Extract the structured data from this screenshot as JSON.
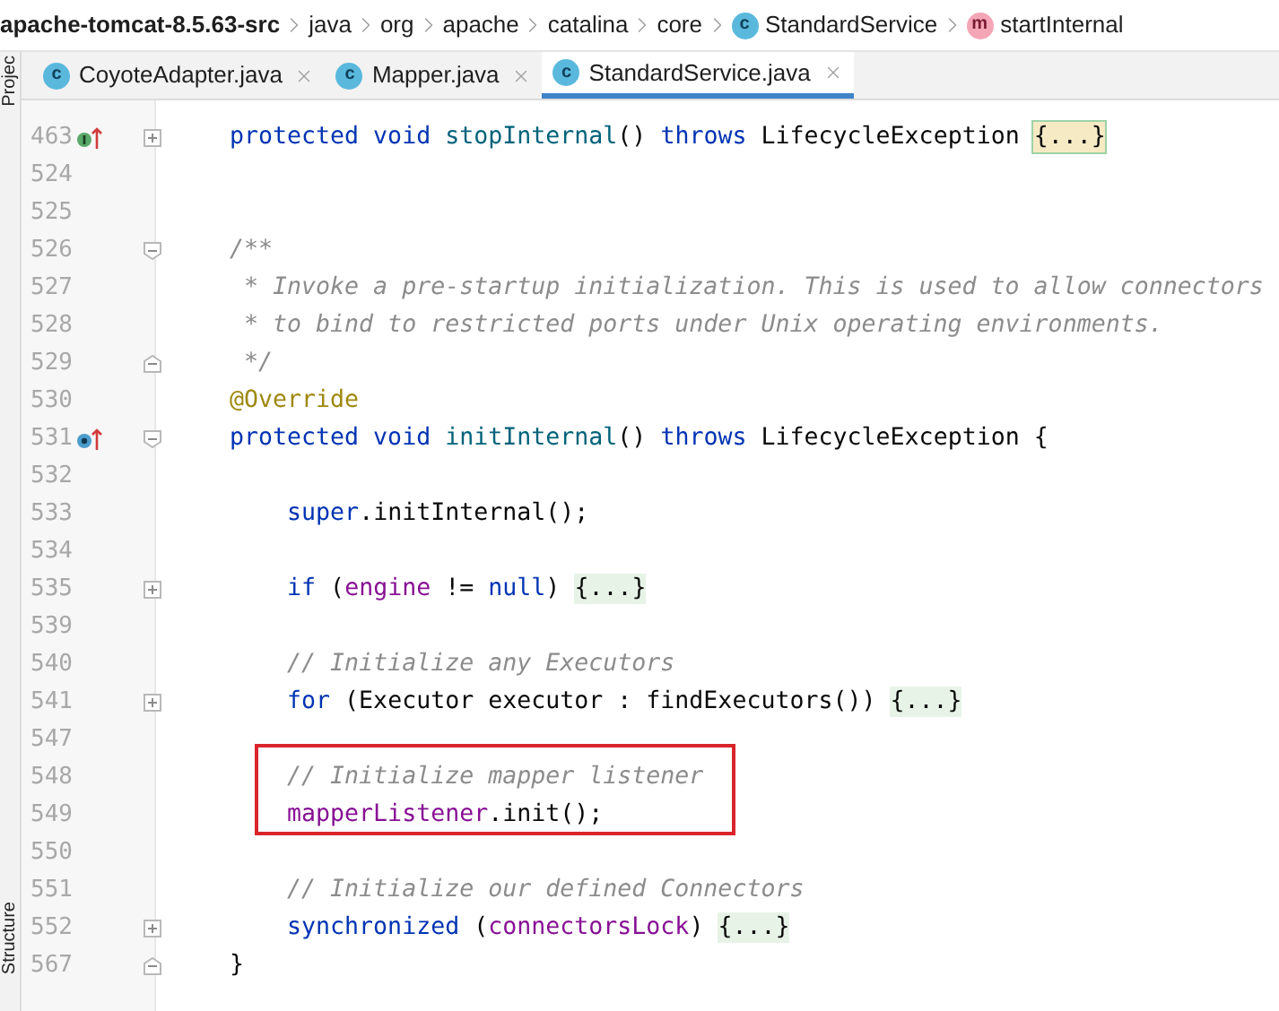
{
  "breadcrumb": [
    {
      "kind": "project",
      "label": "apache-tomcat-8.5.63-src"
    },
    {
      "kind": "folder",
      "label": "java"
    },
    {
      "kind": "folder",
      "label": "org"
    },
    {
      "kind": "folder",
      "label": "apache"
    },
    {
      "kind": "folder",
      "label": "catalina"
    },
    {
      "kind": "folder",
      "label": "core"
    },
    {
      "kind": "class",
      "label": "StandardService",
      "icon_letter": "c"
    },
    {
      "kind": "method",
      "label": "startInternal",
      "icon_letter": "m"
    }
  ],
  "side_tabs": {
    "top": "Projec",
    "bottom": "Structure"
  },
  "tabs": [
    {
      "label": "CoyoteAdapter.java",
      "icon_letter": "c",
      "selected": false
    },
    {
      "label": "Mapper.java",
      "icon_letter": "c",
      "selected": false
    },
    {
      "label": "StandardService.java",
      "icon_letter": "c",
      "selected": true
    }
  ],
  "lines": [
    {
      "number": "463",
      "marker": {
        "kind": "implements"
      },
      "fold": {
        "kind": "collapsed"
      },
      "tokens": [
        {
          "kind": "kw",
          "text": "protected void "
        },
        {
          "kind": "fn",
          "text": "stopInternal"
        },
        {
          "kind": "plain",
          "text": "() "
        },
        {
          "kind": "kw",
          "text": "throws "
        },
        {
          "kind": "plain",
          "text": "LifecycleException "
        },
        {
          "kind": "folded",
          "text": "{...}",
          "highlighted": true
        }
      ]
    },
    {
      "number": "524"
    },
    {
      "number": "525"
    },
    {
      "number": "526",
      "fold": {
        "kind": "open"
      },
      "tokens": [
        {
          "kind": "comment",
          "text": "/**"
        }
      ]
    },
    {
      "number": "527",
      "tokens": [
        {
          "kind": "comment",
          "text": " * Invoke a pre-startup initialization. This is used to allow connectors"
        }
      ]
    },
    {
      "number": "528",
      "tokens": [
        {
          "kind": "comment",
          "text": " * to bind to restricted ports under Unix operating environments."
        }
      ]
    },
    {
      "number": "529",
      "fold": {
        "kind": "close"
      },
      "tokens": [
        {
          "kind": "comment",
          "text": " */"
        }
      ]
    },
    {
      "number": "530",
      "tokens": [
        {
          "kind": "annotation",
          "text": "@Override"
        }
      ]
    },
    {
      "number": "531",
      "marker": {
        "kind": "overrides"
      },
      "fold": {
        "kind": "open"
      },
      "tokens": [
        {
          "kind": "kw",
          "text": "protected void "
        },
        {
          "kind": "fn",
          "text": "initInternal"
        },
        {
          "kind": "plain",
          "text": "() "
        },
        {
          "kind": "kw",
          "text": "throws "
        },
        {
          "kind": "plain",
          "text": "LifecycleException {"
        }
      ]
    },
    {
      "number": "532"
    },
    {
      "number": "533",
      "tokens": [
        {
          "kind": "kw",
          "text": "    super"
        },
        {
          "kind": "plain",
          "text": ".initInternal();"
        }
      ]
    },
    {
      "number": "534"
    },
    {
      "number": "535",
      "fold": {
        "kind": "collapsed"
      },
      "tokens": [
        {
          "kind": "kw",
          "text": "    if "
        },
        {
          "kind": "plain",
          "text": "("
        },
        {
          "kind": "field",
          "text": "engine"
        },
        {
          "kind": "plain",
          "text": " != "
        },
        {
          "kind": "kw",
          "text": "null"
        },
        {
          "kind": "plain",
          "text": ") "
        },
        {
          "kind": "folded",
          "text": "{...}",
          "highlighted": false
        }
      ]
    },
    {
      "number": "539"
    },
    {
      "number": "540",
      "tokens": [
        {
          "kind": "comment",
          "text": "    // Initialize any Executors"
        }
      ]
    },
    {
      "number": "541",
      "fold": {
        "kind": "collapsed"
      },
      "tokens": [
        {
          "kind": "kw",
          "text": "    for "
        },
        {
          "kind": "plain",
          "text": "(Executor executor : findExecutors()) "
        },
        {
          "kind": "folded",
          "text": "{...}",
          "highlighted": false
        }
      ]
    },
    {
      "number": "547"
    },
    {
      "number": "548",
      "boxed": true,
      "tokens": [
        {
          "kind": "comment",
          "text": "    // Initialize mapper listener"
        }
      ]
    },
    {
      "number": "549",
      "boxed": true,
      "tokens": [
        {
          "kind": "field",
          "text": "    mapperListener"
        },
        {
          "kind": "plain",
          "text": ".init();"
        }
      ]
    },
    {
      "number": "550"
    },
    {
      "number": "551",
      "tokens": [
        {
          "kind": "comment",
          "text": "    // Initialize our defined Connectors"
        }
      ]
    },
    {
      "number": "552",
      "fold": {
        "kind": "collapsed"
      },
      "tokens": [
        {
          "kind": "kw",
          "text": "    synchronized "
        },
        {
          "kind": "plain",
          "text": "("
        },
        {
          "kind": "field",
          "text": "connectorsLock"
        },
        {
          "kind": "plain",
          "text": ") "
        },
        {
          "kind": "folded",
          "text": "{...}",
          "highlighted": false
        }
      ]
    },
    {
      "number": "567",
      "fold": {
        "kind": "close"
      },
      "tokens": [
        {
          "kind": "plain",
          "text": "}"
        }
      ]
    }
  ]
}
